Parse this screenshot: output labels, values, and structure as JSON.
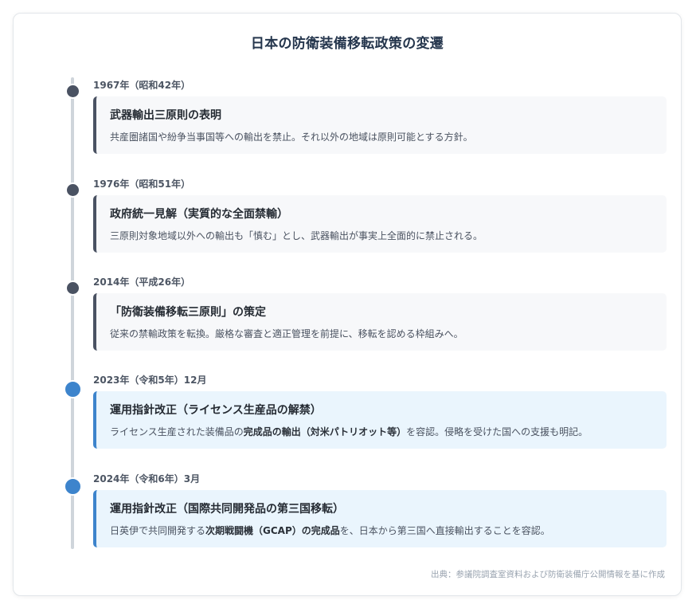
{
  "title": "日本の防衛装備移転政策の変遷",
  "colors": {
    "dot_dark": "#4a5262",
    "dot_blue": "#3d84cc",
    "box_gray": "#f7f8fa",
    "box_blue": "#eaf5fd"
  },
  "events": [
    {
      "date": "1967年（昭和42年）",
      "heading": "武器輸出三原則の表明",
      "desc_parts": [
        "共産圏諸国や紛争当事国等への輸出を禁止。それ以外の地域は原則可能とする方針。"
      ],
      "style": "dark"
    },
    {
      "date": "1976年（昭和51年）",
      "heading": "政府統一見解（実質的な全面禁輸）",
      "desc_parts": [
        "三原則対象地域以外への輸出も「慎む」とし、武器輸出が事実上全面的に禁止される。"
      ],
      "style": "dark"
    },
    {
      "date": "2014年（平成26年）",
      "heading": "「防衛装備移転三原則」の策定",
      "desc_parts": [
        "従来の禁輸政策を転換。厳格な審査と適正管理を前提に、移転を認める枠組みへ。"
      ],
      "style": "dark"
    },
    {
      "date": "2023年（令和5年）12月",
      "heading": "運用指針改正（ライセンス生産品の解禁）",
      "desc_parts": [
        "ライセンス生産された装備品の",
        "完成品の輸出（対米パトリオット等）",
        "を容認。侵略を受けた国への支援も明記。"
      ],
      "style": "blue"
    },
    {
      "date": "2024年（令和6年）3月",
      "heading": "運用指針改正（国際共同開発品の第三国移転）",
      "desc_parts": [
        "日英伊で共同開発する",
        "次期戦闘機（GCAP）の完成品",
        "を、日本から第三国へ直接輸出することを容認。"
      ],
      "style": "blue"
    }
  ],
  "source": "出典：参議院調査室資料および防衛装備庁公開情報を基に作成"
}
